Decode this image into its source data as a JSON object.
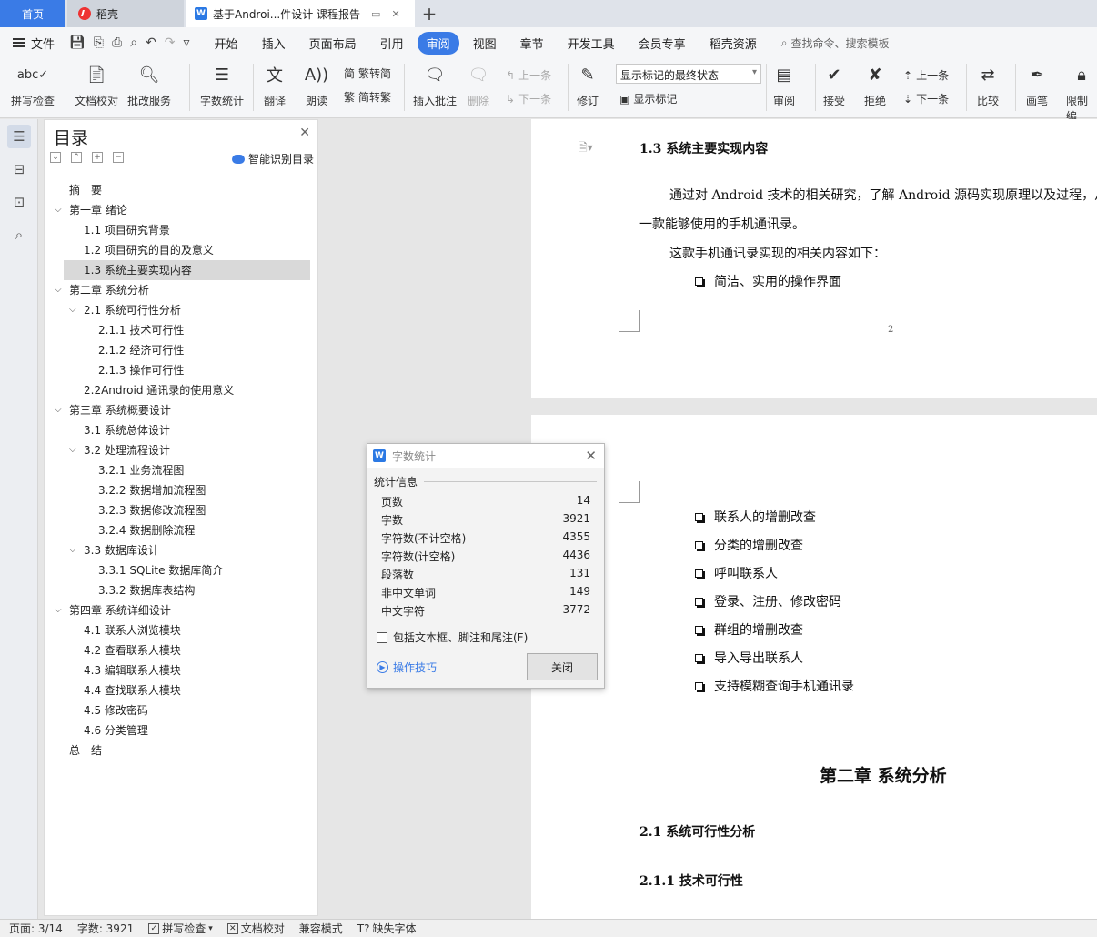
{
  "tabs": {
    "home": "首页",
    "daoke": "稻壳",
    "doc": "基于Androi...件设计 课程报告",
    "new": "+"
  },
  "menu": {
    "file": "文件",
    "items": [
      "开始",
      "插入",
      "页面布局",
      "引用",
      "审阅",
      "视图",
      "章节",
      "开发工具",
      "会员专享",
      "稻壳资源"
    ],
    "active": "审阅",
    "search": "查找命令、搜索模板"
  },
  "ribbon": {
    "spell": "拼写检查",
    "doc_check": "文档校对",
    "approve": "批改服务",
    "word_count": "字数统计",
    "translate": "翻译",
    "read_aloud": "朗读",
    "to_trad": "繁转简",
    "to_simp": "简转繁",
    "insert_comment": "插入批注",
    "delete": "删除",
    "prev_comment": "上一条",
    "next_comment": "下一条",
    "revise": "修订",
    "markup_state": "显示标记的最终状态",
    "show_markup": "显示标记",
    "review": "审阅",
    "accept": "接受",
    "reject": "拒绝",
    "prev": "上一条",
    "next": "下一条",
    "compare": "比较",
    "pen": "画笔",
    "restrict": "限制编"
  },
  "toc": {
    "title": "目录",
    "smart": "智能识别目录",
    "items": [
      {
        "label": "摘　要",
        "level": 0,
        "caret": false
      },
      {
        "label": "第一章  绪论",
        "level": 0,
        "caret": true
      },
      {
        "label": "1.1 项目研究背景",
        "level": 1,
        "caret": false
      },
      {
        "label": "1.2 项目研究的目的及意义",
        "level": 1,
        "caret": false
      },
      {
        "label": "1.3 系统主要实现内容",
        "level": 1,
        "caret": false,
        "active": true
      },
      {
        "label": "第二章  系统分析",
        "level": 0,
        "caret": true
      },
      {
        "label": "2.1 系统可行性分析",
        "level": 1,
        "caret": true
      },
      {
        "label": "2.1.1 技术可行性",
        "level": 2,
        "caret": false
      },
      {
        "label": "2.1.2 经济可行性",
        "level": 2,
        "caret": false
      },
      {
        "label": "2.1.3 操作可行性",
        "level": 2,
        "caret": false
      },
      {
        "label": "2.2Android 通讯录的使用意义",
        "level": 1,
        "caret": false
      },
      {
        "label": "第三章  系统概要设计",
        "level": 0,
        "caret": true
      },
      {
        "label": "3.1 系统总体设计",
        "level": 1,
        "caret": false
      },
      {
        "label": "3.2 处理流程设计",
        "level": 1,
        "caret": true
      },
      {
        "label": "3.2.1 业务流程图",
        "level": 2,
        "caret": false
      },
      {
        "label": "3.2.2 数据增加流程图",
        "level": 2,
        "caret": false
      },
      {
        "label": "3.2.3 数据修改流程图",
        "level": 2,
        "caret": false
      },
      {
        "label": "3.2.4 数据删除流程",
        "level": 2,
        "caret": false
      },
      {
        "label": "3.3  数据库设计",
        "level": 1,
        "caret": true
      },
      {
        "label": "3.3.1 SQLite 数据库简介",
        "level": 2,
        "caret": false
      },
      {
        "label": "3.3.2  数据库表结构",
        "level": 2,
        "caret": false
      },
      {
        "label": "第四章  系统详细设计",
        "level": 0,
        "caret": true
      },
      {
        "label": "4.1 联系人浏览模块",
        "level": 1,
        "caret": false
      },
      {
        "label": "4.2 查看联系人模块",
        "level": 1,
        "caret": false
      },
      {
        "label": "4.3 编辑联系人模块",
        "level": 1,
        "caret": false
      },
      {
        "label": "4.4 查找联系人模块",
        "level": 1,
        "caret": false
      },
      {
        "label": "4.5 修改密码",
        "level": 1,
        "caret": false
      },
      {
        "label": "4.6 分类管理",
        "level": 1,
        "caret": false
      },
      {
        "label": "总　结",
        "level": 0,
        "caret": false
      }
    ]
  },
  "document": {
    "heading_13": "1.3 系统主要实现内容",
    "para1_line1": "通过对 Android 技术的相关研究，了解 Android 源码实现原理以及过程，从而",
    "para1_line2": "一款能够使用的手机通讯录。",
    "para2": "这款手机通讯录实现的相关内容如下：",
    "bullet_p1": "简洁、实用的操作界面",
    "page_number": "2",
    "bullets_p2": [
      "联系人的增删改查",
      "分类的增删改查",
      "呼叫联系人",
      "登录、注册、修改密码",
      "群组的增删改查",
      "导入导出联系人",
      "支持模糊查询手机通讯录"
    ],
    "chapter2": "第二章  系统分析",
    "heading_21": "2.1 系统可行性分析",
    "heading_211": "2.1.1 技术可行性"
  },
  "dialog": {
    "title": "字数统计",
    "section": "统计信息",
    "rows": [
      {
        "label": "页数",
        "value": "14"
      },
      {
        "label": "字数",
        "value": "3921"
      },
      {
        "label": "字符数(不计空格)",
        "value": "4355"
      },
      {
        "label": "字符数(计空格)",
        "value": "4436"
      },
      {
        "label": "段落数",
        "value": "131"
      },
      {
        "label": "非中文单词",
        "value": "149"
      },
      {
        "label": "中文字符",
        "value": "3772"
      }
    ],
    "include_label": "包括文本框、脚注和尾注(F)",
    "tips": "操作技巧",
    "close": "关闭"
  },
  "status": {
    "page": "页面: 3/14",
    "words": "字数: 3921",
    "spell": "拼写检查",
    "doc_check": "文档校对",
    "compat": "兼容模式",
    "missing_font": "缺失字体"
  }
}
